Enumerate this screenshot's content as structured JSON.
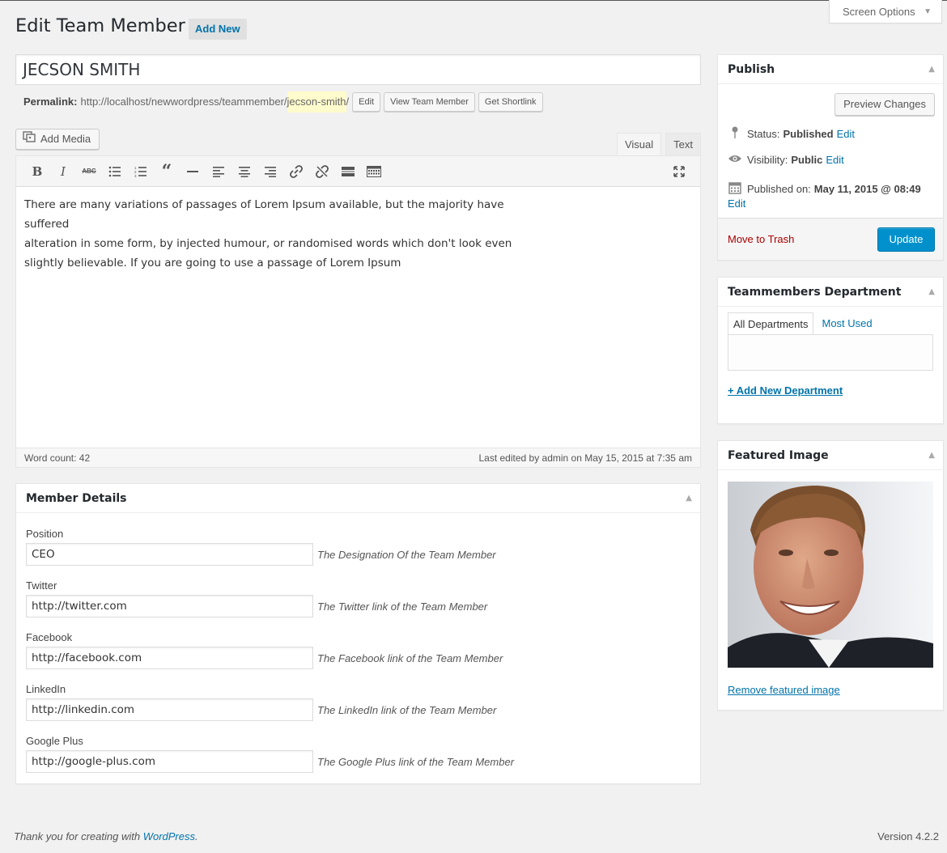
{
  "screen_options": {
    "label": "Screen Options"
  },
  "header": {
    "title": "Edit Team Member",
    "add_new": "Add New"
  },
  "post": {
    "title": "JECSON SMITH",
    "permalink_label": "Permalink:",
    "permalink_base": "http://localhost/newwordpress/teammember/",
    "permalink_slug": "jecson-smith",
    "permalink_trailing": "/",
    "edit_btn": "Edit",
    "view_btn": "View Team Member",
    "shortlink_btn": "Get Shortlink"
  },
  "editor": {
    "add_media": "Add Media",
    "tab_visual": "Visual",
    "tab_text": "Text",
    "content_lines": [
      "There are many variations of passages of Lorem Ipsum available, but the majority have suffered",
      "alteration in some form, by injected humour, or randomised words which don't look even",
      "slightly believable. If you are going to use a passage of Lorem Ipsum"
    ],
    "word_count": "Word count: 42",
    "last_edited": "Last edited by admin on May 15, 2015 at 7:35 am"
  },
  "member_details": {
    "title": "Member Details",
    "fields": [
      {
        "label": "Position",
        "value": "CEO",
        "desc": "The Designation Of the Team Member"
      },
      {
        "label": "Twitter",
        "value": "http://twitter.com",
        "desc": "The Twitter link of the Team Member"
      },
      {
        "label": "Facebook",
        "value": "http://facebook.com",
        "desc": "The Facebook link of the Team Member"
      },
      {
        "label": "LinkedIn",
        "value": "http://linkedin.com",
        "desc": "The LinkedIn link of the Team Member"
      },
      {
        "label": "Google Plus",
        "value": "http://google-plus.com",
        "desc": "The Google Plus link of the Team Member"
      }
    ]
  },
  "publish": {
    "title": "Publish",
    "preview": "Preview Changes",
    "status_label": "Status:",
    "status_value": "Published",
    "visibility_label": "Visibility:",
    "visibility_value": "Public",
    "published_label": "Published on:",
    "published_value": "May 11, 2015 @ 08:49",
    "edit": "Edit",
    "trash": "Move to Trash",
    "update": "Update"
  },
  "department": {
    "title": "Teammembers Department",
    "tab_all": "All Departments",
    "tab_used": "Most Used",
    "add_new": "+ Add New Department"
  },
  "featured": {
    "title": "Featured Image",
    "remove": "Remove featured image"
  },
  "footer": {
    "thanks_prefix": "Thank you for creating with ",
    "wordpress": "WordPress",
    "thanks_suffix": ".",
    "version": "Version 4.2.2"
  },
  "colors": {
    "primary": "#0073aa",
    "update_button": "#0091cd",
    "trash": "#a00",
    "background": "#f1f1f1"
  }
}
